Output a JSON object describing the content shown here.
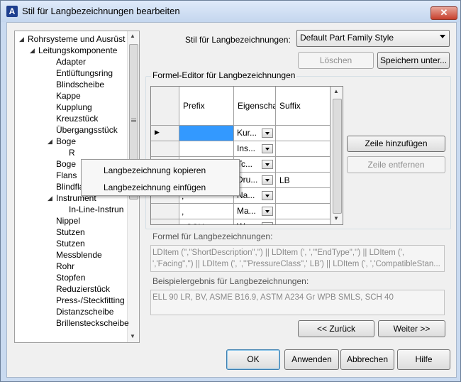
{
  "window": {
    "title": "Stil für Langbezeichnungen bearbeiten",
    "app_icon": "A",
    "close_glyph": "✕"
  },
  "tree": {
    "items": [
      {
        "label": "Rohrsysteme und Ausrüst",
        "arrow": "◢"
      },
      {
        "label": "Leitungskomponente",
        "arrow": "◢"
      },
      {
        "label": "Adapter"
      },
      {
        "label": "Entlüftungsring"
      },
      {
        "label": "Blindscheibe"
      },
      {
        "label": "Kappe"
      },
      {
        "label": "Kupplung"
      },
      {
        "label": "Kreuzstück"
      },
      {
        "label": "Übergangsstück"
      },
      {
        "label": "Boge",
        "arrow": "◢"
      },
      {
        "label": "R"
      },
      {
        "label": "Boge"
      },
      {
        "label": "Flans"
      },
      {
        "label": "Blindflansch"
      },
      {
        "label": "Instrument",
        "arrow": "◢"
      },
      {
        "label": "In-Line-Instrun"
      },
      {
        "label": "Nippel"
      },
      {
        "label": "Stutzen"
      },
      {
        "label": "Stutzen"
      },
      {
        "label": "Messblende"
      },
      {
        "label": "Rohr"
      },
      {
        "label": "Stopfen"
      },
      {
        "label": "Reduzierstück"
      },
      {
        "label": "Press-/Steckfitting"
      },
      {
        "label": "Distanzscheibe"
      },
      {
        "label": "Brillensteckscheibe"
      }
    ]
  },
  "context_menu": {
    "items": [
      "Langbezeichnung kopieren",
      "Langbezeichnung einfügen"
    ]
  },
  "style_label": "Stil für Langbezeichnungen:",
  "style_value": "Default Part Family Style",
  "buttons": {
    "delete": "Löschen",
    "save_as": "Speichern unter...",
    "add_row": "Zeile hinzufügen",
    "remove_row": "Zeile entfernen",
    "back": "<< Zurück",
    "next": "Weiter >>",
    "ok": "OK",
    "apply": "Anwenden",
    "cancel": "Abbrechen",
    "help": "Hilfe"
  },
  "editor": {
    "title": "Formel-Editor für Langbezeichnungen",
    "headers": [
      "Prefix",
      "Eigenscha",
      "Suffix"
    ],
    "rows": [
      {
        "prefix": "",
        "prop": "Kur...",
        "suffix": ""
      },
      {
        "prefix": "",
        "prop": "Ins...",
        "suffix": ""
      },
      {
        "prefix": "",
        "prop": "Tc...",
        "suffix": ""
      },
      {
        "prefix": ",",
        "prop": "Dru...",
        "suffix": "LB"
      },
      {
        "prefix": ",",
        "prop": "Na...",
        "suffix": ""
      },
      {
        "prefix": ",",
        "prop": "Ma...",
        "suffix": ""
      },
      {
        "prefix": ", SCH",
        "prop": "Wa...",
        "suffix": ""
      }
    ]
  },
  "formula": {
    "label": "Formel für Langbezeichnungen:",
    "line1": "LDItem (\",\"ShortDescription\",\") || LDItem (', ','\"EndType\",'') || LDItem (',",
    "line2": "','Facing\",'') || LDItem (', ','\"PressureClass\",' LB') || LDItem (', ','CompatibleStan..."
  },
  "example": {
    "label": "Beispielergebnis für Langbezeichnungen:",
    "value": "ELL 90 LR, BV, ASME B16.9, ASTM A234 Gr WPB SMLS, SCH 40"
  }
}
